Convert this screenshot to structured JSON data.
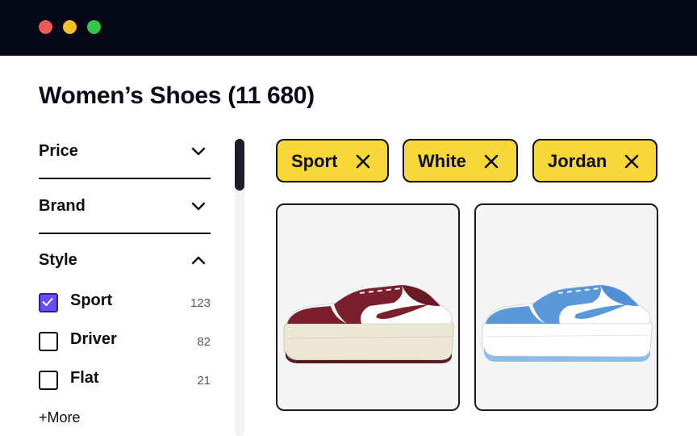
{
  "window": {
    "controls": [
      "close",
      "minimize",
      "maximize"
    ]
  },
  "page": {
    "title": "Women’s Shoes (11 680)"
  },
  "filters": {
    "sections": [
      {
        "label": "Price",
        "icon": "chevron-down-icon"
      },
      {
        "label": "Brand",
        "icon": "chevron-down-icon"
      }
    ],
    "style": {
      "label": "Style",
      "icon": "chevron-up-icon",
      "options": [
        {
          "label": "Sport",
          "count": "123",
          "checked": true
        },
        {
          "label": "Driver",
          "count": "82",
          "checked": false
        },
        {
          "label": "Flat",
          "count": "21",
          "checked": false
        }
      ],
      "more_label": "+More"
    }
  },
  "active_filters": [
    {
      "label": "Sport",
      "icon": "close-icon"
    },
    {
      "label": "White",
      "icon": "close-icon"
    },
    {
      "label": "Jordan",
      "icon": "close-icon"
    }
  ],
  "products": [
    {
      "image": "burgundy-white-sneaker",
      "accent": "#7a1f2b"
    },
    {
      "image": "blue-white-sneaker",
      "accent": "#5a98da"
    }
  ],
  "colors": {
    "titlebar": "#07081a",
    "chip": "#f8d838",
    "checkbox_checked": "#6b4bf5",
    "card_bg": "#f4f4f4"
  }
}
